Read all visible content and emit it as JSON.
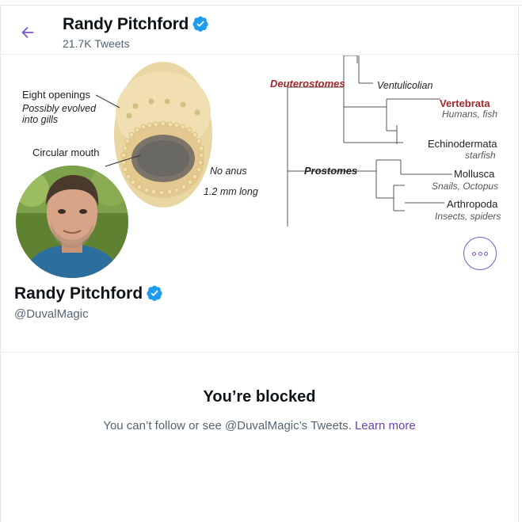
{
  "header": {
    "name": "Randy Pitchford",
    "tweet_count": "21.7K Tweets"
  },
  "banner": {
    "left_labels": {
      "eight_openings": "Eight openings",
      "possibly_evolved_1": "Possibly evolved",
      "possibly_evolved_2": "into gills",
      "circular_mouth": "Circular mouth",
      "no_anus": "No anus",
      "length": "1.2 mm long"
    },
    "tree_labels": {
      "deuterostomes": "Deuterostomes",
      "ventulicolian": "Ventulicolian",
      "vertebrata": "Vertebrata",
      "humans_fish": "Humans, fish",
      "echinodermata": "Echinodermata",
      "starfish": "starfish",
      "prostomes": "Prostomes",
      "mollusca": "Mollusca",
      "snails_octopus": "Snails, Octopus",
      "arthropoda": "Arthropoda",
      "insects_spiders": "Insects, spiders"
    }
  },
  "profile": {
    "name": "Randy Pitchford",
    "handle": "@DuvalMagic"
  },
  "blocked": {
    "title": "You’re blocked",
    "text": "You can’t follow or see @DuvalMagic’s Tweets.",
    "learn_more": "Learn more"
  },
  "colors": {
    "accent": "#7c59c2",
    "verified": "#1d9bf0",
    "vertebrata_red": "#a3262b"
  }
}
